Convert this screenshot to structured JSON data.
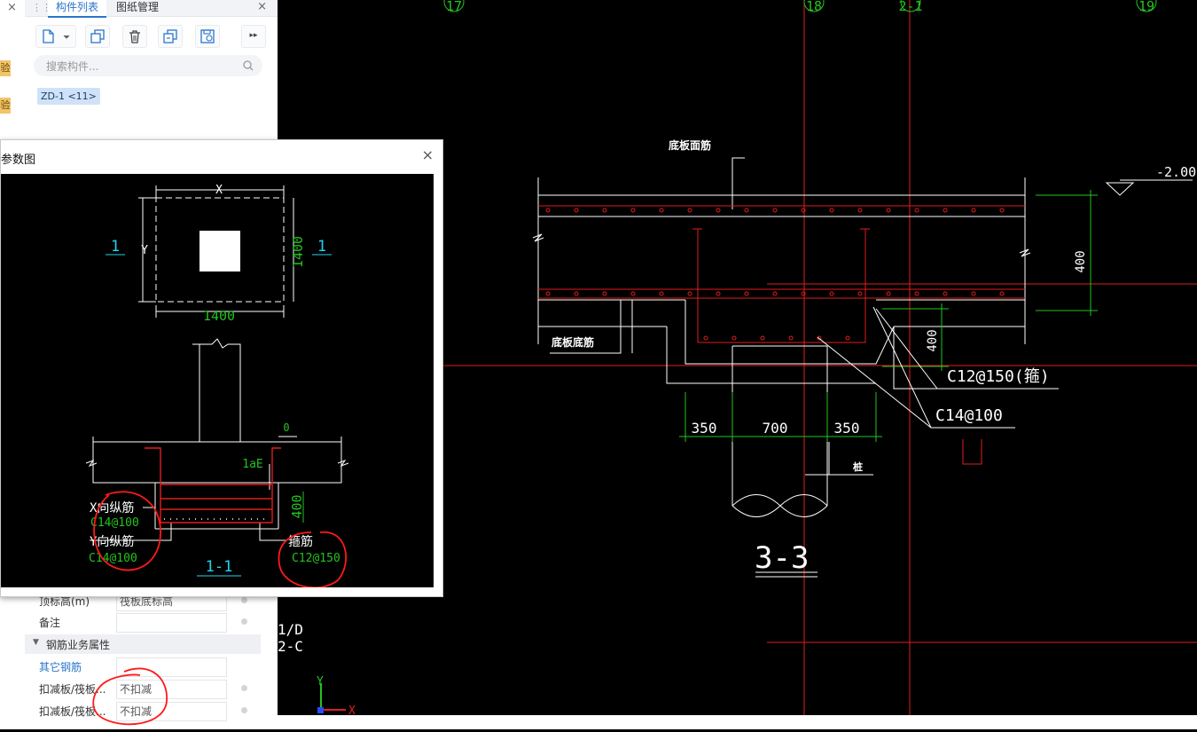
{
  "left_strip": {
    "close": "×",
    "badges": [
      "验",
      "验"
    ]
  },
  "panel": {
    "tabs": [
      "构件列表",
      "图纸管理"
    ],
    "close": "×",
    "search_placeholder": "搜索构件...",
    "component_item": "ZD-1 <11>",
    "more": "▸▸"
  },
  "properties": {
    "rows": [
      {
        "label": "顶标高(m)",
        "value": "筏板底标高"
      },
      {
        "label": "备注",
        "value": ""
      }
    ],
    "section_title": "钢筋业务属性",
    "rebar_rows": [
      {
        "label": "其它钢筋",
        "value": ""
      },
      {
        "label": "扣减板/筏板...",
        "value": "不扣减"
      },
      {
        "label": "扣减板/筏板...",
        "value": "不扣减"
      }
    ]
  },
  "dialog": {
    "title": "参数图",
    "close": "×",
    "drawing": {
      "dim_x": "X",
      "dim_y": "Y",
      "dim_bottom": "1400",
      "dim_right": "1400",
      "section_mark": "1",
      "dim_zero": "0",
      "anchor_label": "1aE",
      "dim_height": "400",
      "x_bar_label": "X向纵筋",
      "x_bar_value": "C14@100",
      "y_bar_label": "Y向纵筋",
      "y_bar_value": "C14@100",
      "stirrup_label": "箍筋",
      "stirrup_value": "C12@150",
      "section_title": "1-1"
    }
  },
  "cad": {
    "axes": [
      "17",
      "18",
      "2-1",
      "19"
    ],
    "elevation": "-2.000",
    "top_rebar": "底板面筋",
    "bottom_rebar": "底板底筋",
    "dim_400_a": "400",
    "dim_400_b": "400",
    "dim_350_left": "350",
    "dim_700": "700",
    "dim_350_right": "350",
    "callout_1": "C12@150(箍)",
    "callout_2": "C14@100",
    "pile_label": "桩",
    "section_title": "3-3",
    "axis_labels": [
      "1/D",
      "2-C"
    ],
    "ucs_y": "Y",
    "ucs_x": "X"
  },
  "colors": {
    "cad_background": "#000000",
    "cad_red": "#e11d1d",
    "cad_green": "#22c41f",
    "cad_cyan": "#22d3ee",
    "annotation_red": "#ff1a1a",
    "tab_active": "#2a75c9"
  }
}
